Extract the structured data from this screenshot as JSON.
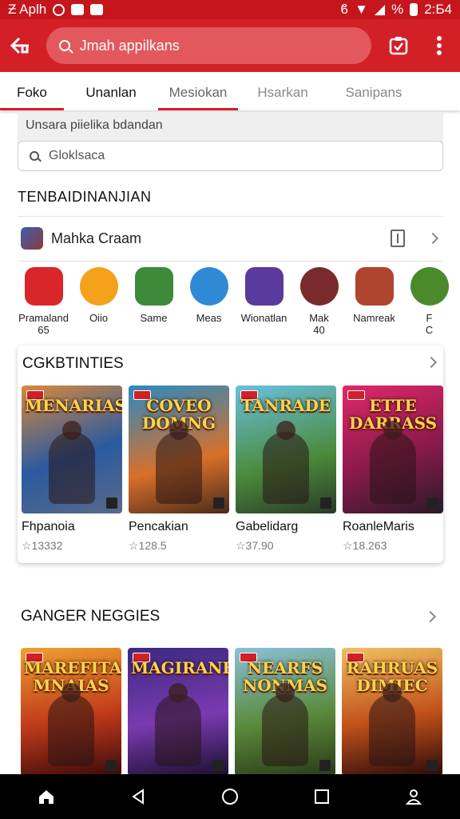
{
  "status": {
    "left_text": "Ƶ Aplh",
    "time": "2:Ƃ4",
    "battery": "%"
  },
  "appbar": {
    "search_placeholder": "Jmah appilkans"
  },
  "tabs": [
    {
      "label": "Foko"
    },
    {
      "label": "Unanlan"
    },
    {
      "label": "Mesiokan"
    },
    {
      "label": "Hsarkan"
    },
    {
      "label": "Sanipans"
    }
  ],
  "panel": {
    "hint": "Unsara piielika bdandan",
    "search_value": "Gloklsaca"
  },
  "section1": {
    "title": "TENBAIDINANJIAN"
  },
  "featured": {
    "name": "Mahka Craam"
  },
  "apps": [
    {
      "label": "Pramaland\n65",
      "color": "#d9262b",
      "icon": "app-red-icon"
    },
    {
      "label": "Oiio",
      "color": "#f4a21b",
      "icon": "app-orange-icon"
    },
    {
      "label": "Same",
      "color": "#3e8a3a",
      "icon": "app-green-icon"
    },
    {
      "label": "Meas",
      "color": "#2f8ad6",
      "icon": "app-blue-icon"
    },
    {
      "label": "Wionatlan",
      "color": "#5b3a9e",
      "icon": "app-purple-icon"
    },
    {
      "label": "Mak\n40",
      "color": "#7a2a2a",
      "icon": "app-sword-icon"
    },
    {
      "label": "Namreak",
      "color": "#b0452f",
      "icon": "app-group-icon"
    },
    {
      "label": "F\nC",
      "color": "#4a8a2a",
      "icon": "app-partial-icon"
    }
  ],
  "card1": {
    "title": "CGKBTINTIES",
    "games": [
      {
        "cover_text": "MENARIAS",
        "name": "Fhpanoia",
        "rating": "☆13332",
        "bg": "linear-gradient(160deg,#d88a3a,#2a5aa0 55%,#5a6a88)"
      },
      {
        "cover_text": "COVEO DOMNG",
        "name": "Pencakian",
        "rating": "☆128.5",
        "bg": "linear-gradient(165deg,#2a8ac0,#d8702a 60%,#4a2a1a)"
      },
      {
        "cover_text": "TANRADE",
        "name": "Gabelidarg",
        "rating": "☆37.90",
        "bg": "linear-gradient(165deg,#6ac0e0,#4a8a3a 60%,#2a3a2a)"
      },
      {
        "cover_text": "ETTE DARRASS",
        "name": "RoanleMaris",
        "rating": "☆18.263",
        "bg": "linear-gradient(160deg,#e0286a,#8a1a4a 55%,#2a1a2a)"
      }
    ]
  },
  "section2": {
    "title": "GANGER NEGGIES",
    "games": [
      {
        "cover_text": "MAREFITA MNAIAS",
        "bg": "linear-gradient(170deg,#f0a030,#c03a1a 55%,#3a0a0a)"
      },
      {
        "cover_text": "MAGIRANES",
        "bg": "linear-gradient(170deg,#3a2a80,#7a3ab0 55%,#1a1030)"
      },
      {
        "cover_text": "NEARFS NONMAS",
        "bg": "linear-gradient(170deg,#8ac0d8,#5a8a3a 55%,#2a3a1a)"
      },
      {
        "cover_text": "RAHRUAS DIMIEC",
        "bg": "linear-gradient(170deg,#f0c060,#c0501a 55%,#2a0a0a)"
      }
    ]
  }
}
